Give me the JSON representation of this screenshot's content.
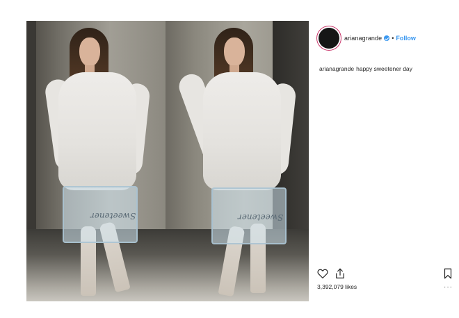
{
  "post": {
    "username": "arianagrande",
    "separator": "•",
    "follow_label": "Follow",
    "caption_user": "arianagrande",
    "caption_text": "happy sweetener day",
    "likes": "3,392,079 likes",
    "bag_text_left": "Sweetener",
    "bag_text_right": "Sweetener"
  },
  "icons": {
    "verified": "verified-badge-icon",
    "like": "heart-icon",
    "share": "share-icon",
    "save": "bookmark-icon",
    "more": "more-icon"
  },
  "colors": {
    "link": "#3897f0",
    "text": "#262626",
    "verified": "#3897f0",
    "avatar_ring": "#c9356a"
  }
}
